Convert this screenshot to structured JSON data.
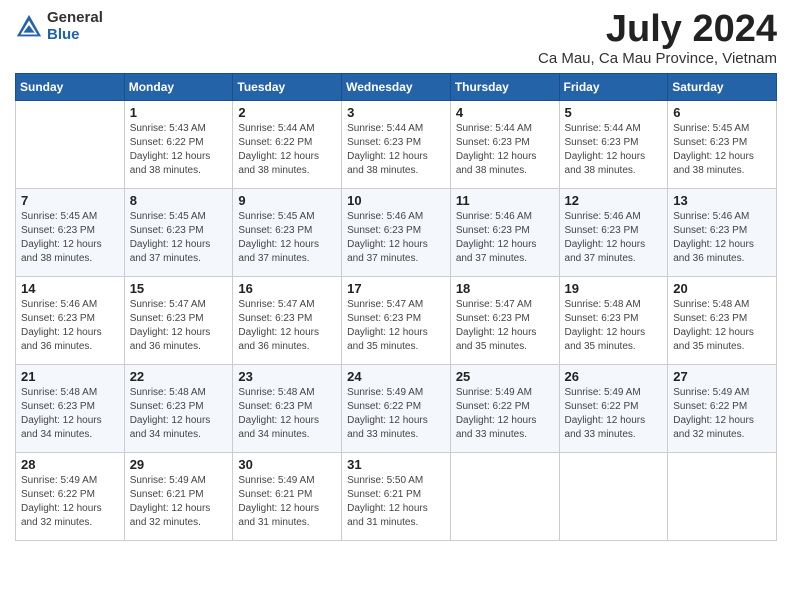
{
  "header": {
    "logo_general": "General",
    "logo_blue": "Blue",
    "month_title": "July 2024",
    "location": "Ca Mau, Ca Mau Province, Vietnam"
  },
  "weekdays": [
    "Sunday",
    "Monday",
    "Tuesday",
    "Wednesday",
    "Thursday",
    "Friday",
    "Saturday"
  ],
  "weeks": [
    [
      {
        "day": "",
        "detail": ""
      },
      {
        "day": "1",
        "detail": "Sunrise: 5:43 AM\nSunset: 6:22 PM\nDaylight: 12 hours\nand 38 minutes."
      },
      {
        "day": "2",
        "detail": "Sunrise: 5:44 AM\nSunset: 6:22 PM\nDaylight: 12 hours\nand 38 minutes."
      },
      {
        "day": "3",
        "detail": "Sunrise: 5:44 AM\nSunset: 6:23 PM\nDaylight: 12 hours\nand 38 minutes."
      },
      {
        "day": "4",
        "detail": "Sunrise: 5:44 AM\nSunset: 6:23 PM\nDaylight: 12 hours\nand 38 minutes."
      },
      {
        "day": "5",
        "detail": "Sunrise: 5:44 AM\nSunset: 6:23 PM\nDaylight: 12 hours\nand 38 minutes."
      },
      {
        "day": "6",
        "detail": "Sunrise: 5:45 AM\nSunset: 6:23 PM\nDaylight: 12 hours\nand 38 minutes."
      }
    ],
    [
      {
        "day": "7",
        "detail": "Sunrise: 5:45 AM\nSunset: 6:23 PM\nDaylight: 12 hours\nand 38 minutes."
      },
      {
        "day": "8",
        "detail": "Sunrise: 5:45 AM\nSunset: 6:23 PM\nDaylight: 12 hours\nand 37 minutes."
      },
      {
        "day": "9",
        "detail": "Sunrise: 5:45 AM\nSunset: 6:23 PM\nDaylight: 12 hours\nand 37 minutes."
      },
      {
        "day": "10",
        "detail": "Sunrise: 5:46 AM\nSunset: 6:23 PM\nDaylight: 12 hours\nand 37 minutes."
      },
      {
        "day": "11",
        "detail": "Sunrise: 5:46 AM\nSunset: 6:23 PM\nDaylight: 12 hours\nand 37 minutes."
      },
      {
        "day": "12",
        "detail": "Sunrise: 5:46 AM\nSunset: 6:23 PM\nDaylight: 12 hours\nand 37 minutes."
      },
      {
        "day": "13",
        "detail": "Sunrise: 5:46 AM\nSunset: 6:23 PM\nDaylight: 12 hours\nand 36 minutes."
      }
    ],
    [
      {
        "day": "14",
        "detail": "Sunrise: 5:46 AM\nSunset: 6:23 PM\nDaylight: 12 hours\nand 36 minutes."
      },
      {
        "day": "15",
        "detail": "Sunrise: 5:47 AM\nSunset: 6:23 PM\nDaylight: 12 hours\nand 36 minutes."
      },
      {
        "day": "16",
        "detail": "Sunrise: 5:47 AM\nSunset: 6:23 PM\nDaylight: 12 hours\nand 36 minutes."
      },
      {
        "day": "17",
        "detail": "Sunrise: 5:47 AM\nSunset: 6:23 PM\nDaylight: 12 hours\nand 35 minutes."
      },
      {
        "day": "18",
        "detail": "Sunrise: 5:47 AM\nSunset: 6:23 PM\nDaylight: 12 hours\nand 35 minutes."
      },
      {
        "day": "19",
        "detail": "Sunrise: 5:48 AM\nSunset: 6:23 PM\nDaylight: 12 hours\nand 35 minutes."
      },
      {
        "day": "20",
        "detail": "Sunrise: 5:48 AM\nSunset: 6:23 PM\nDaylight: 12 hours\nand 35 minutes."
      }
    ],
    [
      {
        "day": "21",
        "detail": "Sunrise: 5:48 AM\nSunset: 6:23 PM\nDaylight: 12 hours\nand 34 minutes."
      },
      {
        "day": "22",
        "detail": "Sunrise: 5:48 AM\nSunset: 6:23 PM\nDaylight: 12 hours\nand 34 minutes."
      },
      {
        "day": "23",
        "detail": "Sunrise: 5:48 AM\nSunset: 6:23 PM\nDaylight: 12 hours\nand 34 minutes."
      },
      {
        "day": "24",
        "detail": "Sunrise: 5:49 AM\nSunset: 6:22 PM\nDaylight: 12 hours\nand 33 minutes."
      },
      {
        "day": "25",
        "detail": "Sunrise: 5:49 AM\nSunset: 6:22 PM\nDaylight: 12 hours\nand 33 minutes."
      },
      {
        "day": "26",
        "detail": "Sunrise: 5:49 AM\nSunset: 6:22 PM\nDaylight: 12 hours\nand 33 minutes."
      },
      {
        "day": "27",
        "detail": "Sunrise: 5:49 AM\nSunset: 6:22 PM\nDaylight: 12 hours\nand 32 minutes."
      }
    ],
    [
      {
        "day": "28",
        "detail": "Sunrise: 5:49 AM\nSunset: 6:22 PM\nDaylight: 12 hours\nand 32 minutes."
      },
      {
        "day": "29",
        "detail": "Sunrise: 5:49 AM\nSunset: 6:21 PM\nDaylight: 12 hours\nand 32 minutes."
      },
      {
        "day": "30",
        "detail": "Sunrise: 5:49 AM\nSunset: 6:21 PM\nDaylight: 12 hours\nand 31 minutes."
      },
      {
        "day": "31",
        "detail": "Sunrise: 5:50 AM\nSunset: 6:21 PM\nDaylight: 12 hours\nand 31 minutes."
      },
      {
        "day": "",
        "detail": ""
      },
      {
        "day": "",
        "detail": ""
      },
      {
        "day": "",
        "detail": ""
      }
    ]
  ]
}
